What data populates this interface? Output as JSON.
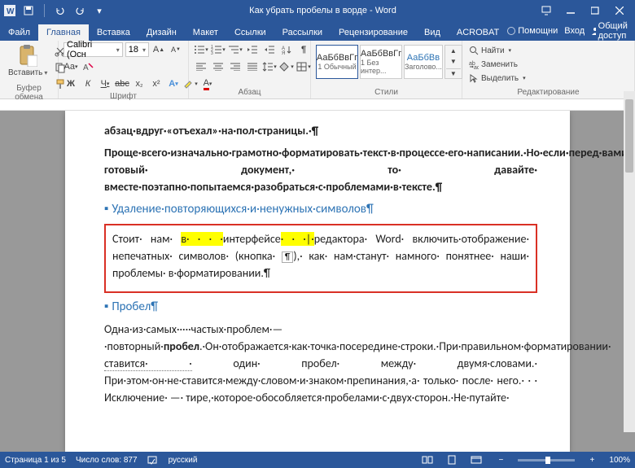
{
  "titlebar": {
    "title": "Как убрать пробелы в ворде - Word"
  },
  "tabs": {
    "file": "Файл",
    "items": [
      "Главная",
      "Вставка",
      "Дизайн",
      "Макет",
      "Ссылки",
      "Рассылки",
      "Рецензирование",
      "Вид",
      "ACROBAT"
    ],
    "active_index": 0,
    "help": "Помощни",
    "signin": "Вход",
    "share": "Общий доступ"
  },
  "ribbon": {
    "clipboard": {
      "paste": "Вставить",
      "label": "Буфер обмена"
    },
    "font": {
      "name": "Calibri (Осн",
      "size": "18",
      "label": "Шрифт"
    },
    "paragraph": {
      "label": "Абзац"
    },
    "styles": {
      "label": "Стили",
      "items": [
        {
          "preview": "АаБбВвГг",
          "name": "1 Обычный"
        },
        {
          "preview": "АаБбВвГг",
          "name": "1 Без интер..."
        },
        {
          "preview": "АаБбВв",
          "name": "Заголово..."
        }
      ]
    },
    "editing": {
      "find": "Найти",
      "replace": "Заменить",
      "select": "Выделить",
      "label": "Редактирование"
    }
  },
  "document": {
    "para1": "абзац·вдруг·«отъехал»·на·пол·страницы.·¶",
    "para2": "Проще·всего·изначально·грамотно·форматировать·текст·в·процессе·его·написании.·Но·если·перед·вами·стоит·задача·отредактировать· готовый· документ,· то· давайте· вместе·поэтапно·попытаемся·разобраться·с·проблемами·в·тексте.¶",
    "heading1": "Удаление·повторяющихся·и·ненужных·символов¶",
    "box_pre": "Стоит· нам· ",
    "box_hl1": "в· · · ·",
    "box_mid1": "интерфейсе",
    "box_hl2": "· · ·|·",
    "box_mid2": "редактора· Word· включить·отображение· непечатных· символов· (кнопка· ",
    "box_btn": "¶",
    "box_end": "),· как· нам·станут· намного· понятнее· наши· проблемы· в·форматировании.¶",
    "heading2": "Пробел¶",
    "para3a": "Одна·из·самых·····частых·проблем·—·повторный·",
    "para3bold": "пробел",
    "para3b": ".·Он·отображается·как·точка·посередине·строки.·При·правильном·форматировании· ",
    "para3u": "ставится· ·",
    "para3c": " один· пробел· между· двумя·словами.· При·этом·он·не·ставится·между·словом·и·знаком·препинания,·а· только· после· него.· · · Исключение· —· тире,·которое·обособляется·пробелами·с·двух·сторон.·Не·путайте·"
  },
  "statusbar": {
    "page": "Страница 1 из 5",
    "words": "Число слов: 877",
    "lang": "русский",
    "zoom": "100%"
  },
  "colors": {
    "brand": "#2b579a"
  }
}
